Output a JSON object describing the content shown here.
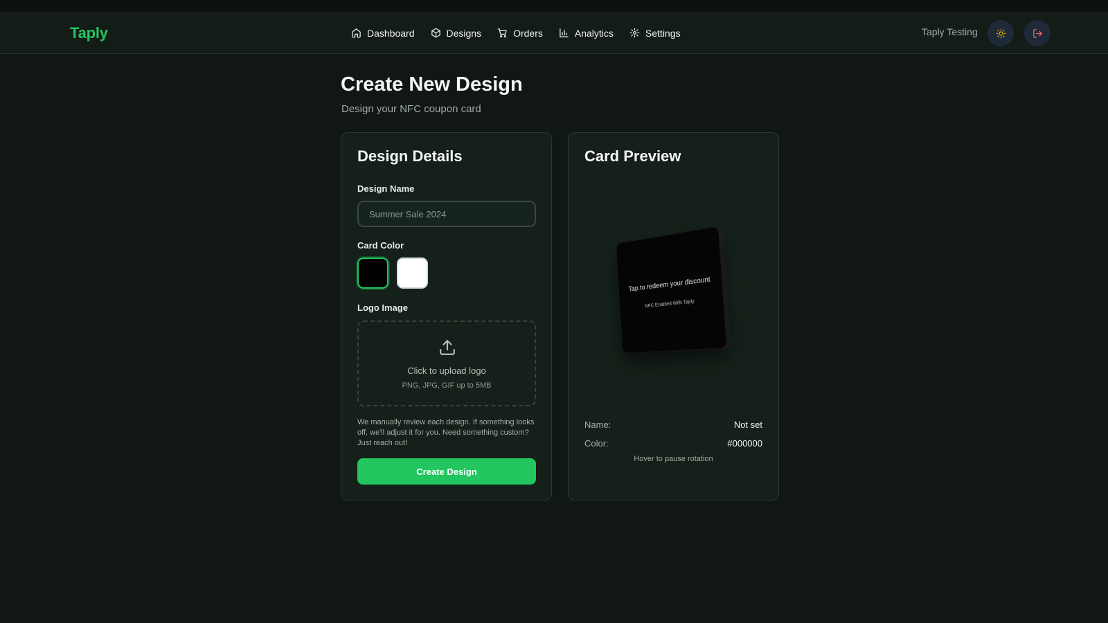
{
  "app": {
    "logo": "Taply",
    "user_name": "Taply Testing"
  },
  "nav": [
    {
      "label": "Dashboard",
      "icon": "home-icon"
    },
    {
      "label": "Designs",
      "icon": "box-icon"
    },
    {
      "label": "Orders",
      "icon": "cart-icon"
    },
    {
      "label": "Analytics",
      "icon": "bar-chart-icon"
    },
    {
      "label": "Settings",
      "icon": "gear-icon"
    }
  ],
  "header_actions": {
    "theme_icon": "sun-icon",
    "logout_icon": "logout-icon"
  },
  "page": {
    "title": "Create New Design",
    "subtitle": "Design your NFC coupon card"
  },
  "design_details": {
    "title": "Design Details",
    "name_label": "Design Name",
    "name_placeholder": "Summer Sale 2024",
    "name_value": "",
    "color_label": "Card Color",
    "colors": [
      {
        "name": "black",
        "hex": "#000000",
        "selected": true
      },
      {
        "name": "white",
        "hex": "#ffffff",
        "selected": false
      }
    ],
    "logo_label": "Logo Image",
    "upload_title": "Click to upload logo",
    "upload_hint": "PNG, JPG, GIF up to 5MB",
    "note": "We manually review each design. If something looks off, we'll adjust it for you. Need something custom? Just reach out!",
    "create_button": "Create Design"
  },
  "card_preview": {
    "title": "Card Preview",
    "card_text_primary": "Tap to redeem your discount",
    "card_text_secondary": "NFC Enabled With Taply",
    "name_label": "Name:",
    "name_value": "Not set",
    "color_label": "Color:",
    "color_value": "#000000",
    "hint": "Hover to pause rotation"
  },
  "colors": {
    "accent": "#22c55e",
    "background": "#111714",
    "panel": "#142019"
  }
}
